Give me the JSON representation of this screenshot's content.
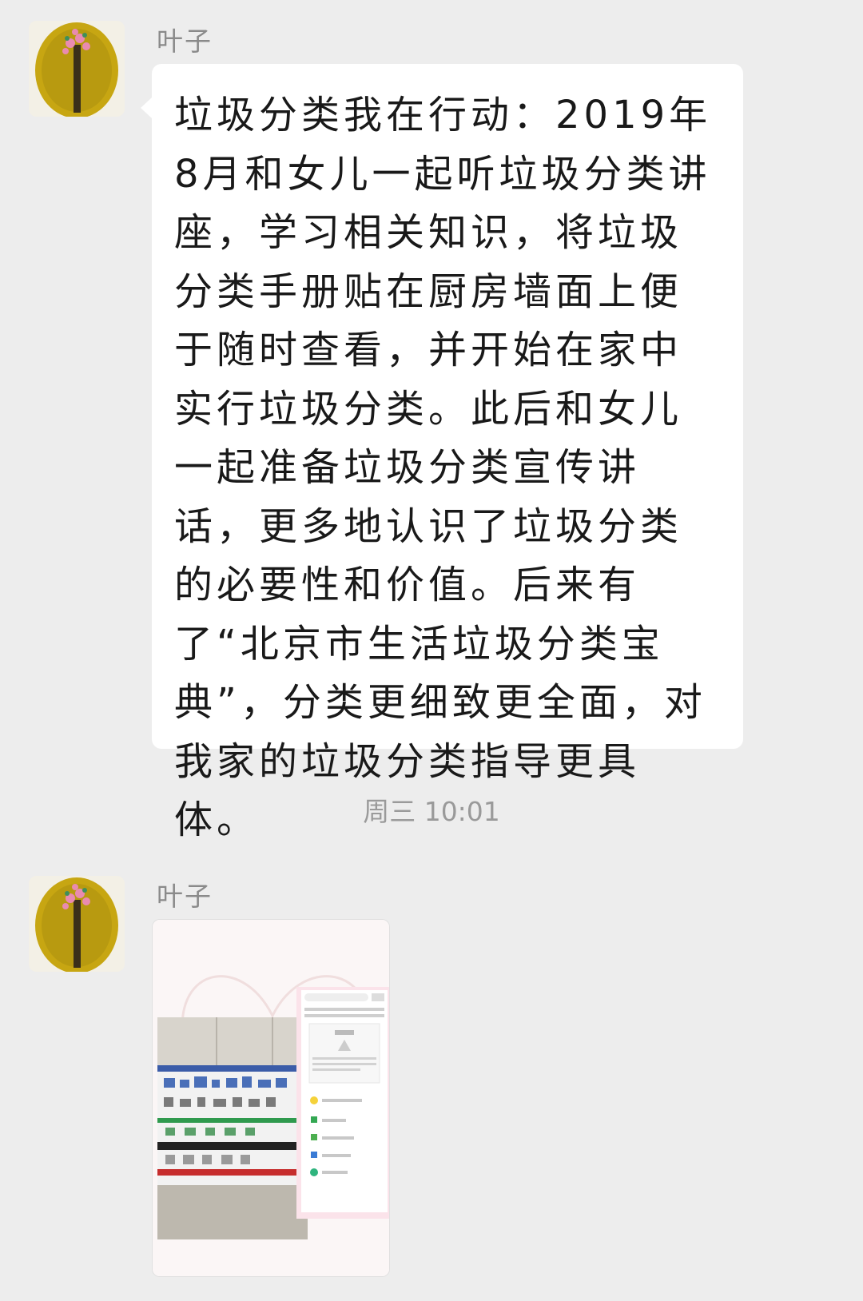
{
  "messages": [
    {
      "sender": "叶子",
      "type": "text",
      "text": "垃圾分类我在行动：2019年8月和女儿一起听垃圾分类讲座，学习相关知识，将垃圾分类手册贴在厨房墙面上便于随时查看，并开始在家中实行垃圾分类。此后和女儿一起准备垃圾分类宣传讲话，更多地认识了垃圾分类的必要性和价值。后来有了“北京市生活垃圾分类宝典”，分类更细致更全面，对我家的垃圾分类指导更具体。"
    },
    {
      "sender": "叶子",
      "type": "image",
      "image_icon": "photo-thumbnail-icon"
    }
  ],
  "timestamp": "周三 10:01",
  "colors": {
    "background": "#ededed",
    "bubble": "#ffffff",
    "text": "#191919",
    "meta": "#8a8a8a"
  }
}
